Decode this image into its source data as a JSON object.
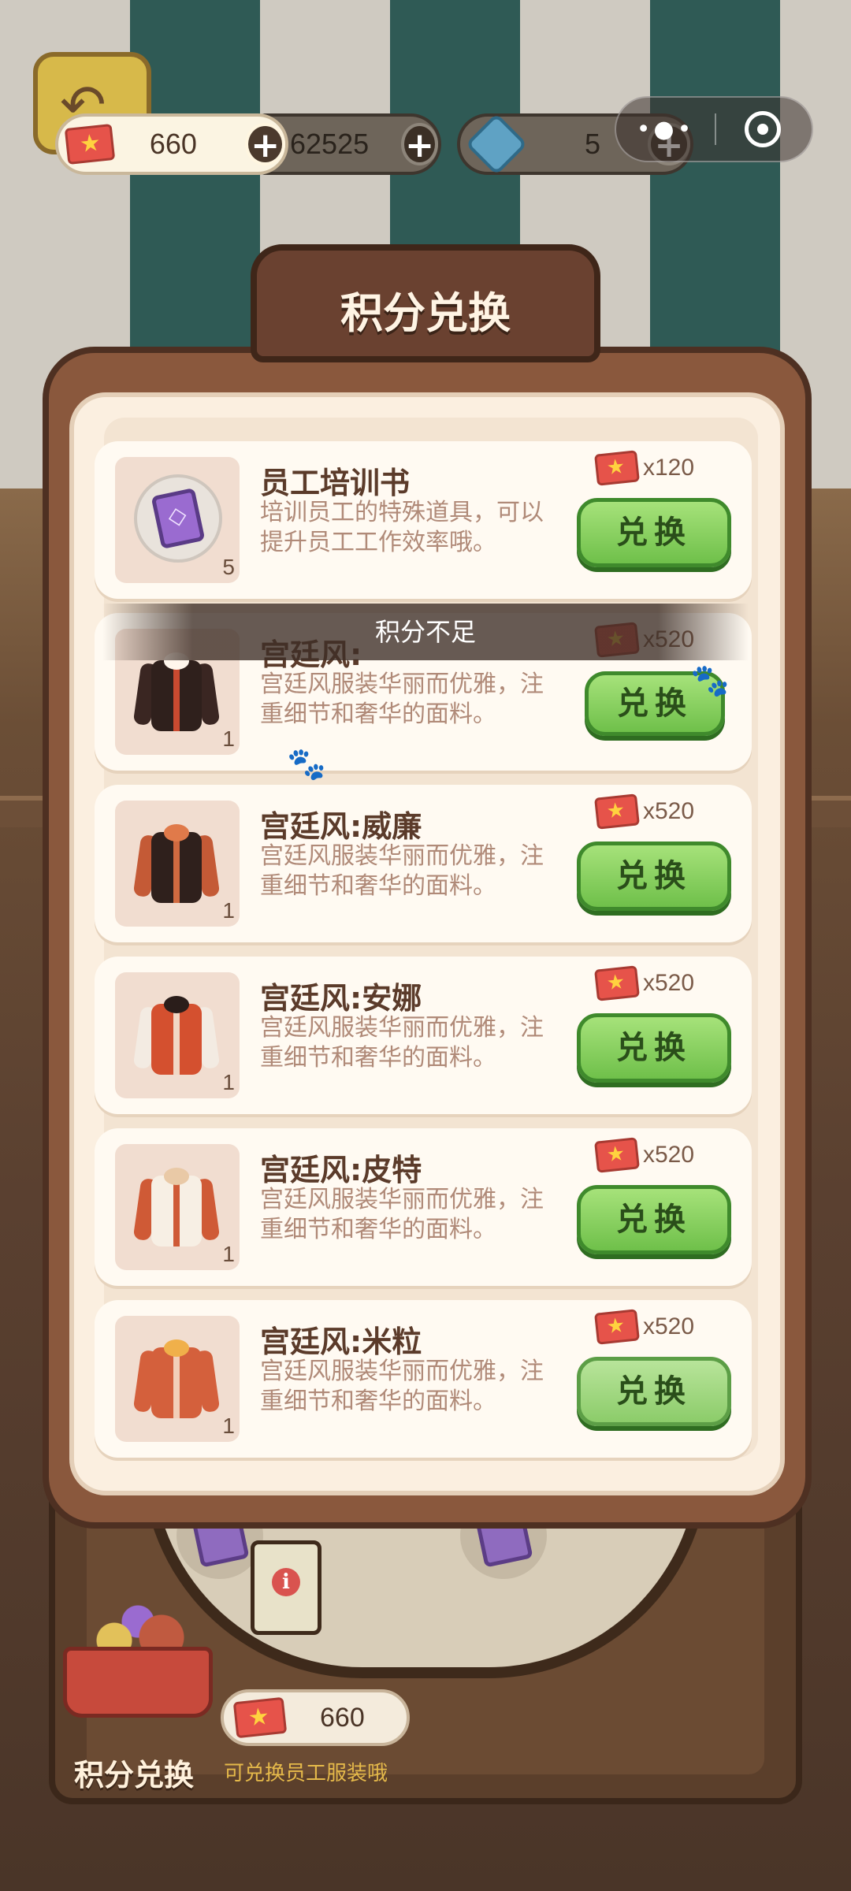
{
  "currencies": {
    "tickets": "660",
    "coins": "62525",
    "gems": "5"
  },
  "mini_program_capsule": {
    "menu_icon": "more-dots-icon",
    "close_icon": "target-close-icon"
  },
  "panel": {
    "title": "积分兑换",
    "toast": "积分不足",
    "button_label": "兑换",
    "items": [
      {
        "name": "员工培训书",
        "desc": "培训员工的特殊道具，可以提升员工工作效率哦。",
        "qty": "5",
        "cost": "x120",
        "icon": "training-book-icon"
      },
      {
        "name": "宫廷风:",
        "desc": "宫廷风服装华丽而优雅，注重细节和奢华的面料。",
        "qty": "1",
        "cost": "x520",
        "icon": "court-outfit-black-icon"
      },
      {
        "name": "宫廷风:威廉",
        "desc": "宫廷风服装华丽而优雅，注重细节和奢华的面料。",
        "qty": "1",
        "cost": "x520",
        "icon": "court-outfit-william-icon"
      },
      {
        "name": "宫廷风:安娜",
        "desc": "宫廷风服装华丽而优雅，注重细节和奢华的面料。",
        "qty": "1",
        "cost": "x520",
        "icon": "court-outfit-anna-icon"
      },
      {
        "name": "宫廷风:皮特",
        "desc": "宫廷风服装华丽而优雅，注重细节和奢华的面料。",
        "qty": "1",
        "cost": "x520",
        "icon": "court-outfit-pete-icon"
      },
      {
        "name": "宫廷风:米粒",
        "desc": "宫廷风服装华丽而优雅，注重细节和奢华的面料。",
        "qty": "1",
        "cost": "x520",
        "icon": "court-outfit-mili-icon"
      }
    ]
  },
  "bottom": {
    "tickets": "660",
    "label": "积分兑换",
    "sub": "可兑换员工服装哦"
  },
  "colors": {
    "button_green": "#6fc04a",
    "ticket_red": "#e6534a",
    "panel_brown": "#8a583d"
  }
}
